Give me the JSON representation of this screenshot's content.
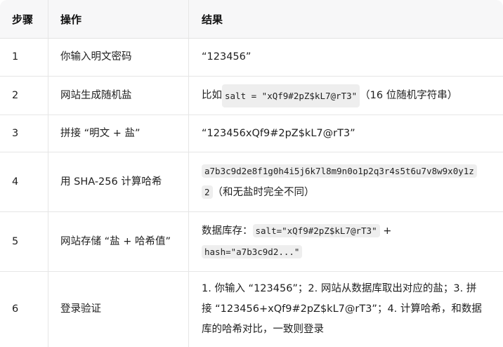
{
  "headers": {
    "step": "步骤",
    "action": "操作",
    "result": "结果"
  },
  "rows": [
    {
      "step": "1",
      "action": "你输入明文密码",
      "result": "“123456”"
    },
    {
      "step": "2",
      "action": "网站生成随机盐",
      "result_pre": "比如 ",
      "result_code": "salt = \"xQf9#2pZ$kL7@rT3\"",
      "result_post": "（16 位随机字符串）"
    },
    {
      "step": "3",
      "action": "拼接 “明文 + 盐”",
      "result": "“123456xQf9#2pZ$kL7@rT3”"
    },
    {
      "step": "4",
      "action": "用 SHA-256 计算哈希",
      "result_code_line1": "a7b3c9d2e8f1g0h4i5j6k7l8m9n0o1p2q3r4s5t6u7v8w9x0y1z",
      "result_code_line2": "2",
      "result_post": "（和无盐时完全不同）"
    },
    {
      "step": "5",
      "action": "网站存储 “盐 + 哈希值”",
      "result_pre": "数据库存：",
      "result_code1": "salt=\"xQf9#2pZ$kL7@rT3\"",
      "result_mid": " +",
      "result_code2": "hash=\"a7b3c9d2...\""
    },
    {
      "step": "6",
      "action": "登录验证",
      "result_line1": "1. 你输入 “123456”；2. 网站从数据库取出对应的盐；3. 拼",
      "result_line2": "接 “123456+xQf9#2pZ$kL7@rT3”；4. 计算哈希，和数据",
      "result_line3": "库的哈希对比，一致则登录"
    }
  ]
}
